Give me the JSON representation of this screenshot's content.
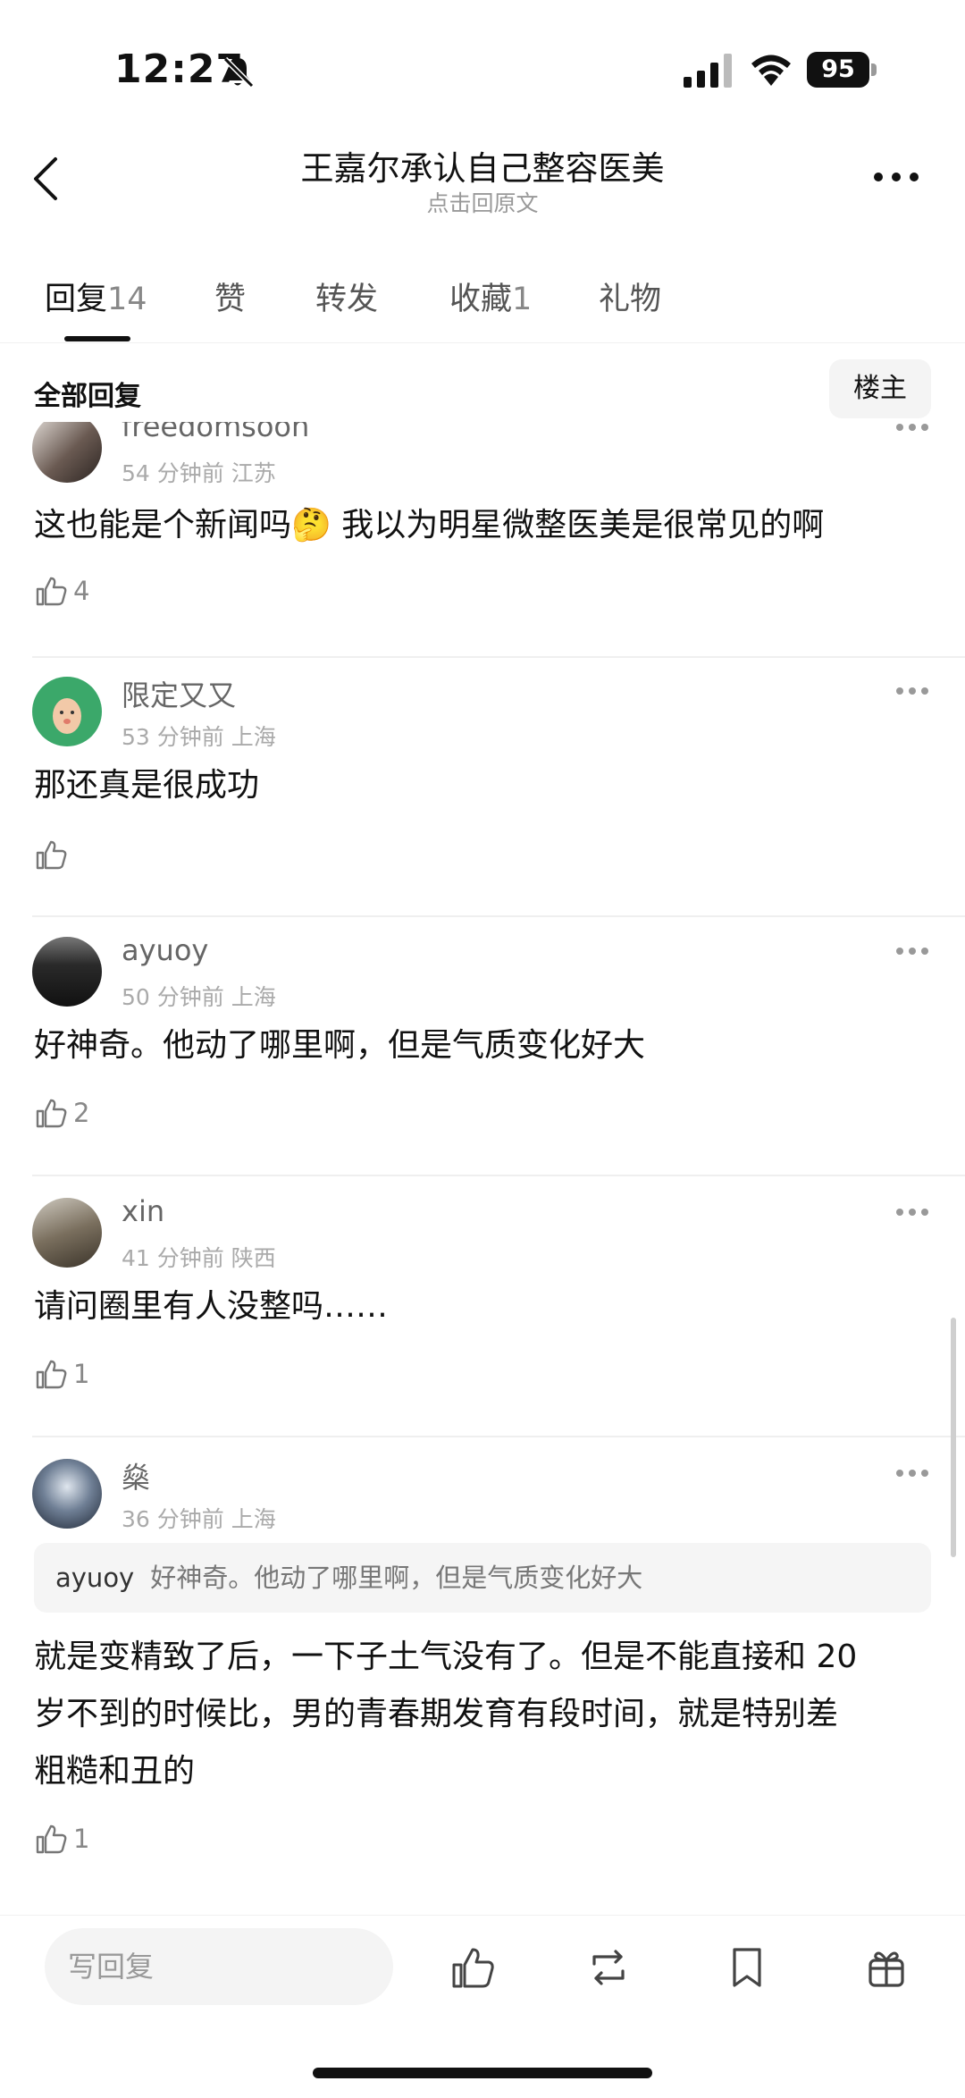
{
  "status_bar": {
    "time": "12:27",
    "battery": "95"
  },
  "header": {
    "title": "王嘉尔承认自己整容医美",
    "subtitle": "点击回原文"
  },
  "tabs": [
    {
      "label": "回复",
      "count": "14"
    },
    {
      "label": "赞",
      "count": ""
    },
    {
      "label": "转发",
      "count": ""
    },
    {
      "label": "收藏",
      "count": "1"
    },
    {
      "label": "礼物",
      "count": ""
    }
  ],
  "filter": {
    "label": "全部回复",
    "op_button": "楼主"
  },
  "comments": [
    {
      "user": "freedomsoon",
      "time": "54 分钟前",
      "location": "江苏",
      "text": "这也能是个新闻吗🤔 我以为明星微整医美是很常见的啊",
      "likes": "4"
    },
    {
      "user": "限定又又",
      "time": "53 分钟前",
      "location": "上海",
      "text": "那还真是很成功",
      "likes": ""
    },
    {
      "user": "ayuoy",
      "time": "50 分钟前",
      "location": "上海",
      "text": "好神奇。他动了哪里啊，但是气质变化好大",
      "likes": "2"
    },
    {
      "user": "xin",
      "time": "41 分钟前",
      "location": "陕西",
      "text": "请问圈里有人没整吗……",
      "likes": "1"
    },
    {
      "user": "燊",
      "time": "36 分钟前",
      "location": "上海",
      "quote_user": "ayuoy",
      "quote_text": "好神奇。他动了哪里啊，但是气质变化好大",
      "text_lines": [
        "就是变精致了后，一下子土气没有了。但是不能直接和 20",
        "岁不到的时候比，男的青春期发育有段时间，就是特别差",
        "粗糙和丑的"
      ],
      "likes": "1"
    }
  ],
  "bottom_bar": {
    "reply_placeholder": "写回复"
  }
}
